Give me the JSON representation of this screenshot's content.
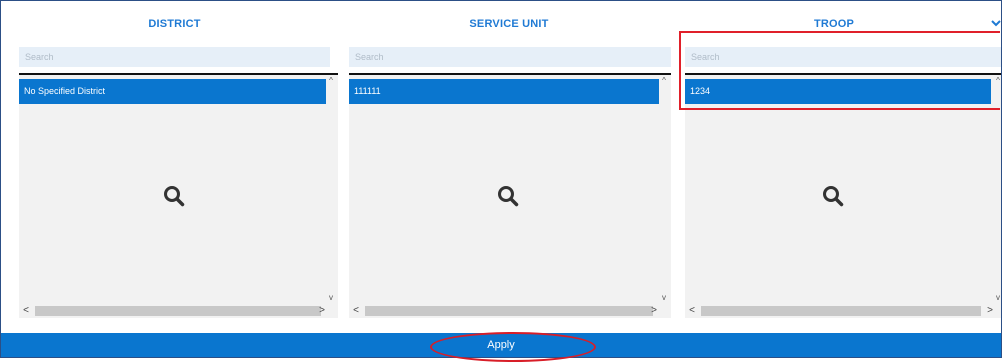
{
  "columns": [
    {
      "header": "DISTRICT",
      "search_placeholder": "Search",
      "selected_item": "No Specified District"
    },
    {
      "header": "SERVICE UNIT",
      "search_placeholder": "Search",
      "selected_item": "111111"
    },
    {
      "header": "TROOP",
      "search_placeholder": "Search",
      "selected_item": "1234"
    }
  ],
  "apply_label": "Apply",
  "icons": {
    "list_placeholder": "search-icon",
    "header_toggle": "chevron-down-icon"
  },
  "colors": {
    "accent": "#0a76cf",
    "header_text": "#1f7ad4",
    "annotation": "#e0202a"
  }
}
